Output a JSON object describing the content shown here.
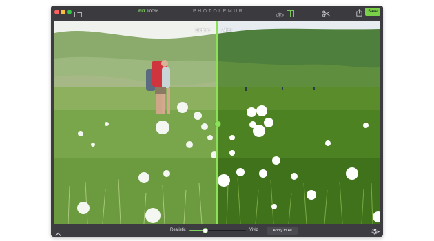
{
  "app": {
    "title": "PHOTOLEMUR"
  },
  "toolbar": {
    "fit_label": "FIT",
    "zoom_value": "100%",
    "save_label": "Save"
  },
  "photo": {
    "before_label": "Before",
    "after_label": "After"
  },
  "adjust": {
    "low_label": "Realistic",
    "high_label": "Vivid",
    "level": 0.28,
    "apply_label": "Apply to All"
  },
  "icons": {
    "folder": "folder-icon",
    "eye": "eye-icon",
    "compare": "split-view-icon",
    "crop": "scissors-icon",
    "share": "share-icon",
    "collapse": "chevron-up-icon",
    "settings": "gear-icon"
  },
  "colors": {
    "accent": "#7fd65f",
    "save_button": "#7bd04a",
    "window_bg": "#3c3c41"
  }
}
